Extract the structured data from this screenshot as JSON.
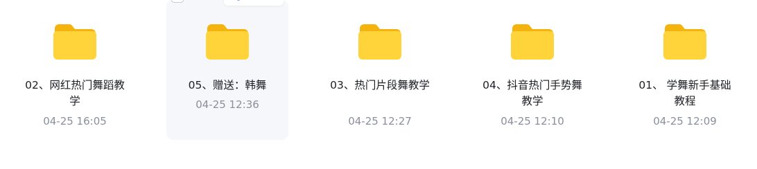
{
  "colors": {
    "folder_back": "#f5b40d",
    "folder_front": "#ffd43b",
    "name_text": "#1d1f25",
    "date_text": "#8a8f9c",
    "hover_bg": "#f6f7fa",
    "accent": "#4a7df0"
  },
  "files": [
    {
      "name": "02、网红热门舞蹈教学",
      "date": "04-25 16:05",
      "icon": "folder-icon"
    },
    {
      "name": "05、赠送：韩舞",
      "date": "04-25 12:36",
      "icon": "folder-icon",
      "hovered": true
    },
    {
      "name": "03、热门片段舞教学",
      "date": "04-25 12:27",
      "icon": "folder-icon"
    },
    {
      "name": "04、抖音热门手势舞教学",
      "date": "04-25 12:10",
      "icon": "folder-icon"
    },
    {
      "name": "01、 学舞新手基础教程",
      "date": "04-25 12:09",
      "icon": "folder-icon"
    }
  ],
  "hover_actions": [
    "link-icon",
    "download-icon"
  ]
}
